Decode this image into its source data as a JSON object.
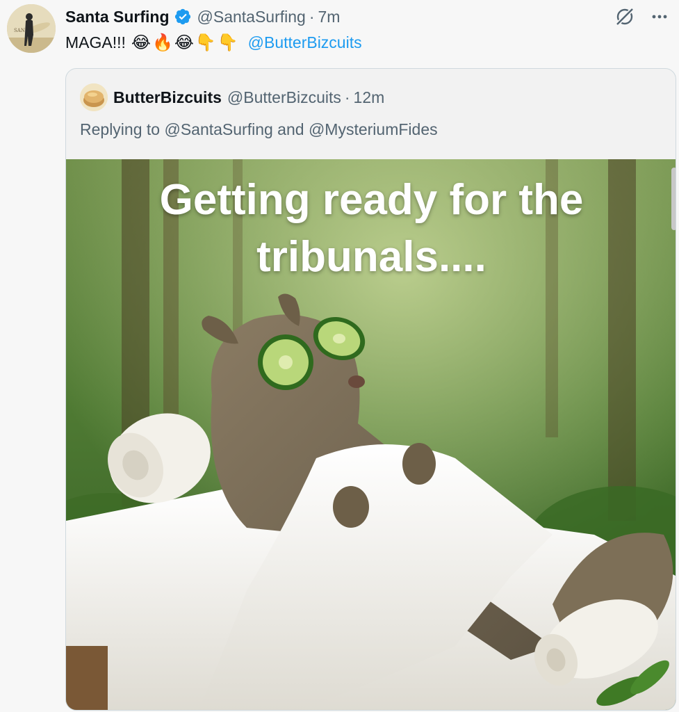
{
  "tweet": {
    "display_name": "Santa Surfing",
    "handle": "@SantaSurfing",
    "separator": "·",
    "time": "7m",
    "text": "MAGA!!!",
    "emojis": "😂🔥😂👇👇",
    "mention": "@ButterBizcuits",
    "avatar_icon": "santa-surfing-avatar",
    "verified_icon": "verified-badge-icon",
    "verified_color": "#1d9bf0"
  },
  "actions": {
    "grok_icon": "grok-icon",
    "more_icon": "more-icon"
  },
  "quote": {
    "display_name": "ButterBizcuits",
    "handle": "@ButterBizcuits",
    "separator": "·",
    "time": "12m",
    "reply_prefix": "Replying to ",
    "reply_user1": "@SantaSurfing",
    "reply_and": " and ",
    "reply_user2": "@MysteriumFides",
    "avatar_icon": "butter-biscuit-avatar",
    "media": {
      "caption": "Getting ready for the tribunals....",
      "image": "squirrel-spa-image"
    }
  },
  "colors": {
    "link": "#1d9bf0",
    "secondary_text": "#536471",
    "border": "#cfd9de"
  }
}
